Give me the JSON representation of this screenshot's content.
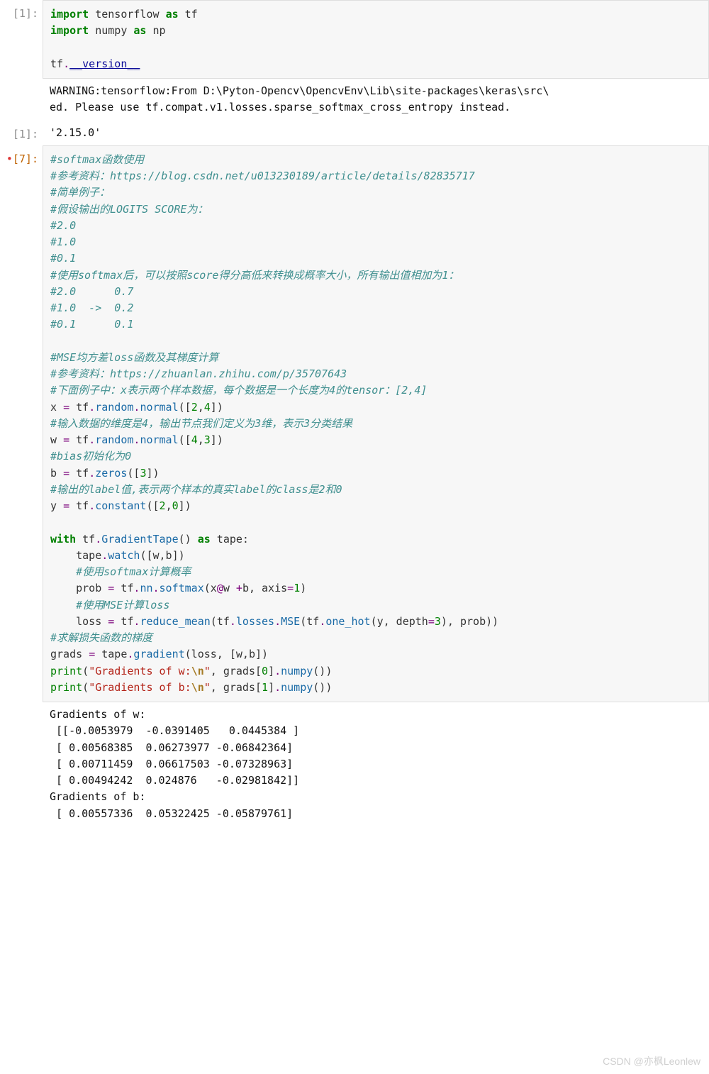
{
  "cells": {
    "c1": {
      "prompt": "[1]:",
      "lines": {
        "l1a": "import",
        "l1b": " tensorflow ",
        "l1c": "as",
        "l1d": " tf",
        "l2a": "import",
        "l2b": " numpy ",
        "l2c": "as",
        "l2d": " np",
        "l4a": "tf",
        "l4b": ".",
        "l4c": "__version__"
      }
    },
    "o1": {
      "prompt": "",
      "text": "WARNING:tensorflow:From D:\\Pyton-Opencv\\OpencvEnv\\Lib\\site-packages\\keras\\src\\\ned. Please use tf.compat.v1.losses.sparse_softmax_cross_entropy instead."
    },
    "o2": {
      "prompt": "[1]:",
      "text": "'2.15.0'"
    },
    "c2": {
      "prompt": "[7]:",
      "lines": {
        "l01": "#softmax函数使用",
        "l02": "#参考资料：https://blog.csdn.net/u013230189/article/details/82835717",
        "l03": "#简单例子：",
        "l04": "#假设输出的LOGITS SCORE为：",
        "l05": "#2.0",
        "l06": "#1.0",
        "l07": "#0.1",
        "l08": "#使用softmax后，可以按照score得分高低来转换成概率大小，所有输出值相加为1：",
        "l09": "#2.0      0.7",
        "l10": "#1.0  ->  0.2",
        "l11": "#0.1      0.1",
        "l12": "",
        "l13": "#MSE均方差loss函数及其梯度计算",
        "l14": "#参考资料：https://zhuanlan.zhihu.com/p/35707643",
        "l15": "#下面例子中：x表示两个样本数据，每个数据是一个长度为4的tensor：[2,4]",
        "x_a": "x ",
        "x_b": "=",
        "x_c": " tf",
        "x_d": ".",
        "x_e": "random",
        "x_f": ".",
        "x_g": "normal",
        "x_h": "([",
        "x_i": "2",
        "x_j": ",",
        "x_k": "4",
        "x_l": "])",
        "l17": "#输入数据的维度是4，输出节点我们定义为3维，表示3分类结果",
        "w_a": "w ",
        "w_b": "=",
        "w_c": " tf",
        "w_d": ".",
        "w_e": "random",
        "w_f": ".",
        "w_g": "normal",
        "w_h": "([",
        "w_i": "4",
        "w_j": ",",
        "w_k": "3",
        "w_l": "])",
        "l19": "#bias初始化为0",
        "b_a": "b ",
        "b_b": "=",
        "b_c": " tf",
        "b_d": ".",
        "b_e": "zeros",
        "b_f": "([",
        "b_g": "3",
        "b_h": "])",
        "l21": "#输出的label值,表示两个样本的真实label的class是2和0",
        "y_a": "y ",
        "y_b": "=",
        "y_c": " tf",
        "y_d": ".",
        "y_e": "constant",
        "y_f": "([",
        "y_g": "2",
        "y_h": ",",
        "y_i": "0",
        "y_j": "])",
        "wth_a": "with",
        "wth_b": " tf",
        "wth_c": ".",
        "wth_d": "GradientTape",
        "wth_e": "() ",
        "wth_f": "as",
        "wth_g": " tape:",
        "t1": "    tape",
        "t2": ".",
        "t3": "watch",
        "t4": "([w,b])",
        "l27": "    #使用softmax计算概率",
        "p1": "    prob ",
        "p2": "=",
        "p3": " tf",
        "p4": ".",
        "p5": "nn",
        "p6": ".",
        "p7": "softmax",
        "p8": "(x",
        "p9": "@",
        "p10": "w ",
        "p11": "+",
        "p12": "b, axis",
        "p13": "=",
        "p14": "1",
        "p15": ")",
        "l29": "    #使用MSE计算loss",
        "ls1": "    loss ",
        "ls2": "=",
        "ls3": " tf",
        "ls4": ".",
        "ls5": "reduce_mean",
        "ls6": "(tf",
        "ls7": ".",
        "ls8": "losses",
        "ls9": ".",
        "ls10": "MSE",
        "ls11": "(tf",
        "ls12": ".",
        "ls13": "one_hot",
        "ls14": "(y, depth",
        "ls15": "=",
        "ls16": "3",
        "ls17": "), prob))",
        "l31": "#求解损失函数的梯度",
        "g1": "grads ",
        "g2": "=",
        "g3": " tape",
        "g4": ".",
        "g5": "gradient",
        "g6": "(loss, [w,b])",
        "pr1a": "print",
        "pr1b": "(",
        "pr1c": "\"Gradients of w:",
        "pr1d": "\\n",
        "pr1e": "\"",
        "pr1f": ", grads[",
        "pr1g": "0",
        "pr1h": "]",
        "pr1i": ".",
        "pr1j": "numpy",
        "pr1k": "())",
        "pr2a": "print",
        "pr2b": "(",
        "pr2c": "\"Gradients of b:",
        "pr2d": "\\n",
        "pr2e": "\"",
        "pr2f": ", grads[",
        "pr2g": "1",
        "pr2h": "]",
        "pr2i": ".",
        "pr2j": "numpy",
        "pr2k": "())"
      }
    },
    "o3": {
      "prompt": "",
      "text": "Gradients of w:\n [[-0.0053979  -0.0391405   0.0445384 ]\n [ 0.00568385  0.06273977 -0.06842364]\n [ 0.00711459  0.06617503 -0.07328963]\n [ 0.00494242  0.024876   -0.02981842]]\nGradients of b:\n [ 0.00557336  0.05322425 -0.05879761]"
    }
  },
  "watermark": "CSDN @亦枫Leonlew"
}
